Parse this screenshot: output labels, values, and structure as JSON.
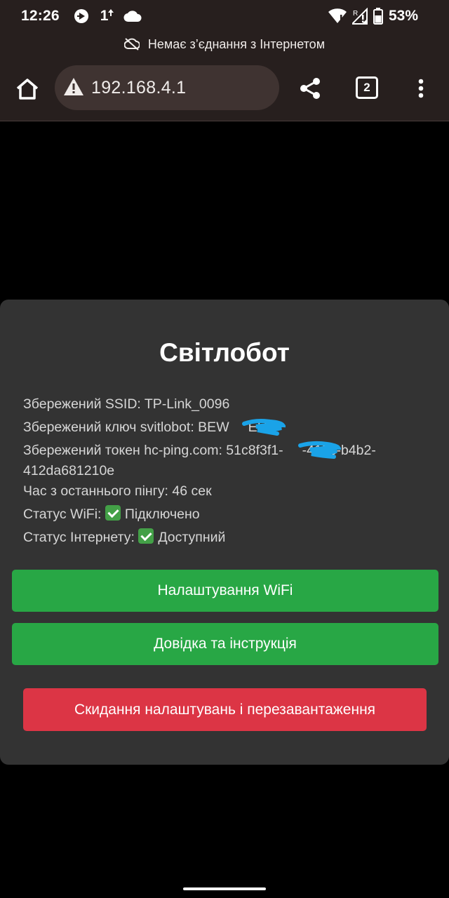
{
  "status_bar": {
    "time": "12:26",
    "signal_badge": "1",
    "battery_percent": "53%",
    "icons": [
      "media-record-icon",
      "signal-one-icon",
      "cloud-icon",
      "wifi-icon",
      "roaming-signal-icon",
      "battery-icon"
    ]
  },
  "offline_banner": {
    "text": "Немає з’єднання з Інтернетом",
    "icon": "cloud-off-icon"
  },
  "toolbar": {
    "url": "192.168.4.1",
    "tab_count": "2",
    "icons": [
      "home-icon",
      "warning-icon",
      "share-icon",
      "tabs-icon",
      "more-vert-icon"
    ]
  },
  "page": {
    "title": "Світлобот",
    "info": {
      "ssid": "Збережений SSID: TP-Link_0096",
      "key": "Збережений ключ svitlobot: BEW     EHT",
      "token_line1": "Збережений токен hc-ping.com: 51c8f3f1-     -415c-b4b2-",
      "token_line2": "412da681210e",
      "last_ping": "Час з останнього пінгу: 46 сек",
      "wifi_status_label": "Статус WiFi:",
      "wifi_status_value": "Підключено",
      "internet_status_label": "Статус Інтернету:",
      "internet_status_value": "Доступний"
    },
    "buttons": {
      "wifi_settings": "Налаштування WiFi",
      "help": "Довідка та інструкція",
      "reset": "Скидання налаштувань і перезавантаження"
    }
  },
  "colors": {
    "browser_chrome": "#271f1e",
    "omnibox": "#3f3331",
    "card": "#333333",
    "green_button": "#28a745",
    "red_button": "#dc3545",
    "redaction_scribble": "#1aa3e8"
  }
}
